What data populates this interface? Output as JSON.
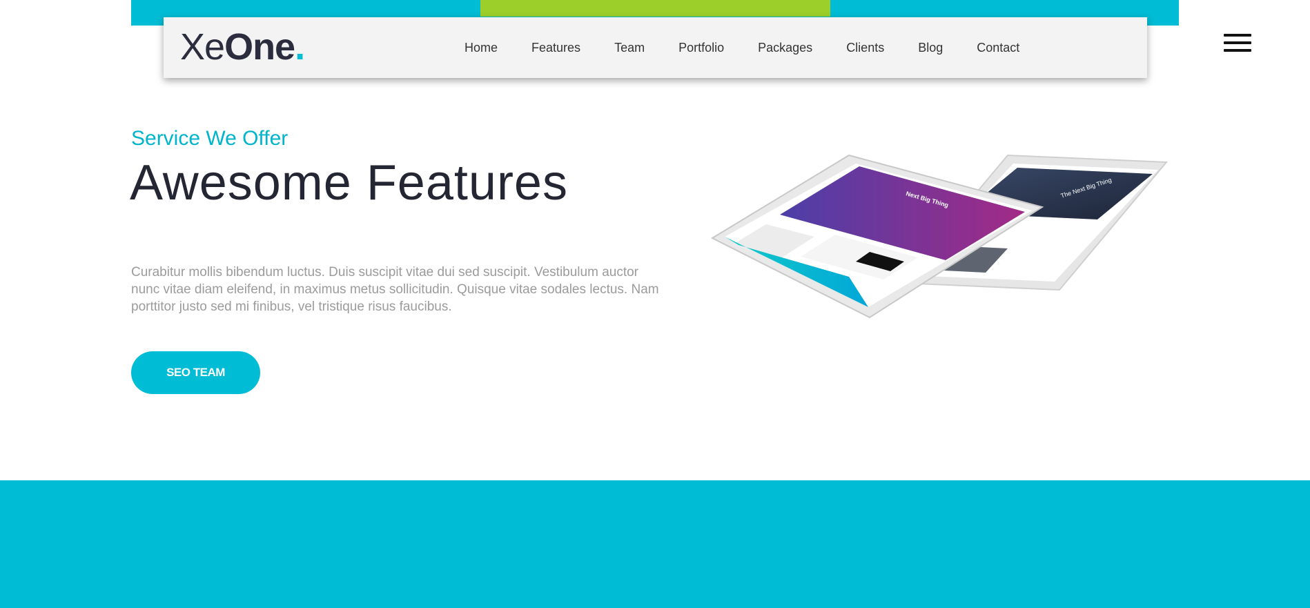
{
  "brand": {
    "logo_thin": "Xe",
    "logo_bold": "One",
    "logo_dot": ".",
    "accent": "#00bcd4",
    "accent_secondary": "#9ccf2a"
  },
  "nav": {
    "items": [
      {
        "label": "Home"
      },
      {
        "label": "Features"
      },
      {
        "label": "Team"
      },
      {
        "label": "Portfolio"
      },
      {
        "label": "Packages"
      },
      {
        "label": "Clients"
      },
      {
        "label": "Blog"
      },
      {
        "label": "Contact"
      }
    ],
    "menu_icon": "hamburger-menu-icon"
  },
  "hero": {
    "subtitle": "Service We Offer",
    "title": "Awesome Features",
    "body": "Curabitur mollis bibendum luctus. Duis suscipit vitae dui sed suscipit. Vestibulum auctor nunc vitae diam eleifend, in maximus metus sollicitudin. Quisque vitae sodales lectus. Nam porttitor justo sed mi finibus, vel tristique risus faucibus.",
    "cta_label": "SEO TEAM"
  },
  "device_mockup": {
    "front_screen_title": "Next Big Thing",
    "back_screen_title": "The Next Big Thing"
  }
}
